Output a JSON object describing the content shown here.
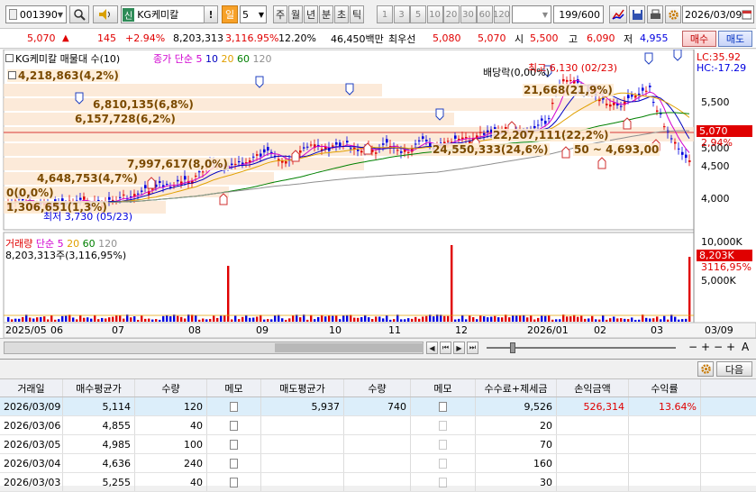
{
  "toolbar": {
    "code": "001390",
    "name": "KG케미칼",
    "period_active": "일",
    "period_value": "5",
    "periods": [
      "주",
      "월",
      "년",
      "분",
      "초",
      "틱"
    ],
    "numbers": [
      "1",
      "3",
      "5",
      "10",
      "20",
      "30",
      "60",
      "120"
    ],
    "count": "199/600",
    "date": "2026/03/09"
  },
  "info": {
    "price": "5,070",
    "change": "145",
    "change_pct": "+2.94%",
    "volume": "8,203,313",
    "volume_pct": "3,116.95%",
    "turnover": "12.20%",
    "amount": "46,450백만",
    "best_label": "최우선",
    "best1": "5,080",
    "best2": "5,070",
    "open_label": "시",
    "open": "5,500",
    "high_label": "고",
    "high": "6,090",
    "low_label": "저",
    "low": "4,955",
    "buy": "매수",
    "sell": "매도"
  },
  "chart": {
    "title": "KG케미칼 매물대 수(10)",
    "ma_title": "종가 단순",
    "ma_values": [
      "5",
      "10",
      "20",
      "60",
      "120"
    ],
    "lc": "LC:35.92",
    "hc": "HC:-17.29",
    "vol_box": "4,218,863(4,2%)",
    "bands": [
      "6,810,135(6,8%)",
      "6,157,728(6,2%)",
      "7,997,617(8,0%)",
      "4,648,753(4,7%)",
      "0(0,0%)",
      "1,306,651(1,3%)",
      "24,550,333(24,6%)",
      "22,207,111(22,2%)",
      "21,668(21,9%)"
    ],
    "dividend": "배당락(0,00%)",
    "high_note": "최고 6,130 (02/23)",
    "low_note": "최저 3,730 (05/23)",
    "range_note": "50 ~ 4,693,00",
    "y_ticks": [
      "5,500",
      "5,000",
      "4,500",
      "4,000"
    ],
    "price_tag": "5,070",
    "price_tag_pct": "2,94%",
    "vol_title": "거래량",
    "vol_ma": "단순",
    "vol_ma_values": [
      "5",
      "20",
      "60",
      "120"
    ],
    "vol_value": "8,203,313주(3,116,95%)",
    "vol_ticks": [
      "10,000K",
      "5,000K"
    ],
    "vol_tag": "8,203K",
    "vol_tag_pct": "3116,95%",
    "x_labels": [
      "2025/05",
      "06",
      "07",
      "08",
      "09",
      "10",
      "11",
      "12",
      "2026/01",
      "02",
      "03"
    ],
    "x_last": "03/09"
  },
  "table": {
    "next": "다음",
    "headers": [
      "거래일",
      "매수평균가",
      "수량",
      "메모",
      "매도평균가",
      "수량",
      "메모",
      "수수료+제세금",
      "손익금액",
      "수익률"
    ],
    "rows": [
      {
        "date": "2026/03/09",
        "buy_avg": "5,114",
        "qty": "120",
        "sell_avg": "5,937",
        "sell_qty": "740",
        "fee": "9,526",
        "pnl": "526,314",
        "rate": "13.64%"
      },
      {
        "date": "2026/03/06",
        "buy_avg": "4,855",
        "qty": "40",
        "sell_avg": "",
        "sell_qty": "",
        "fee": "20",
        "pnl": "",
        "rate": ""
      },
      {
        "date": "2026/03/05",
        "buy_avg": "4,985",
        "qty": "100",
        "sell_avg": "",
        "sell_qty": "",
        "fee": "70",
        "pnl": "",
        "rate": ""
      },
      {
        "date": "2026/03/04",
        "buy_avg": "4,636",
        "qty": "240",
        "sell_avg": "",
        "sell_qty": "",
        "fee": "160",
        "pnl": "",
        "rate": ""
      },
      {
        "date": "2026/03/03",
        "buy_avg": "5,255",
        "qty": "40",
        "sell_avg": "",
        "sell_qty": "",
        "fee": "30",
        "pnl": "",
        "rate": ""
      }
    ]
  },
  "colors": {
    "up": "#e00000",
    "down": "#0000e0",
    "ma5": "#d000d0",
    "ma10": "#0000c0",
    "ma20": "#e0a000",
    "ma60": "#008000",
    "ma120": "#909090"
  },
  "icons": [
    "search-icon",
    "speaker-icon",
    "alarm-icon",
    "chart-icon",
    "save-icon",
    "printer-icon",
    "settings-icon",
    "calendar-icon",
    "scroll-left-icon",
    "scroll-right-icon",
    "zoom-in-icon",
    "zoom-out-icon",
    "memo-icon"
  ]
}
